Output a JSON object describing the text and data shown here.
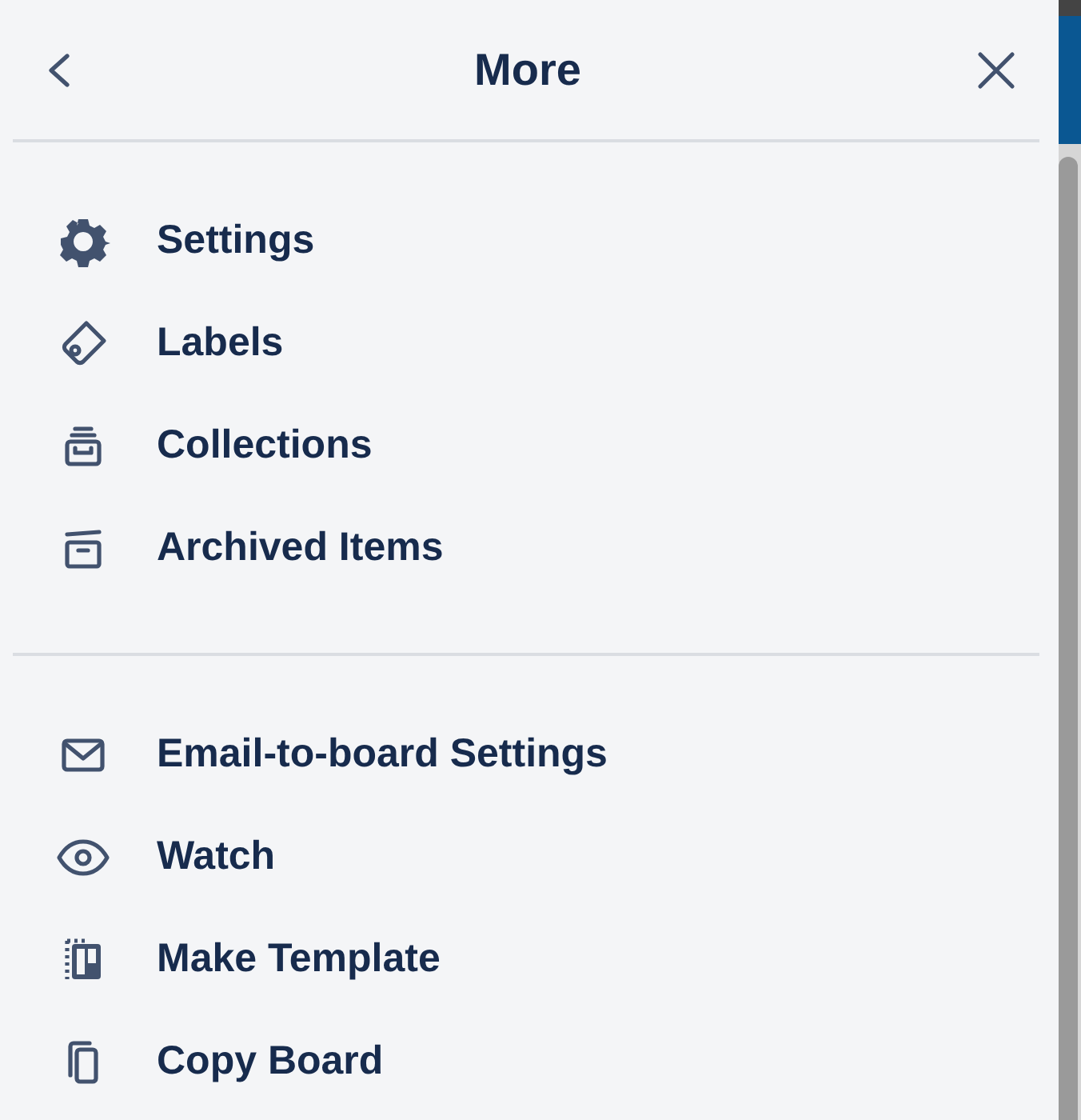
{
  "header": {
    "title": "More"
  },
  "sections": [
    {
      "items": [
        {
          "label": "Settings",
          "kind": "gear"
        },
        {
          "label": "Labels",
          "kind": "tag"
        },
        {
          "label": "Collections",
          "kind": "collection"
        },
        {
          "label": "Archived Items",
          "kind": "archive"
        }
      ]
    },
    {
      "items": [
        {
          "label": "Email-to-board Settings",
          "kind": "email"
        },
        {
          "label": "Watch",
          "kind": "eye"
        },
        {
          "label": "Make Template",
          "kind": "template"
        },
        {
          "label": "Copy Board",
          "kind": "copy"
        }
      ]
    }
  ]
}
